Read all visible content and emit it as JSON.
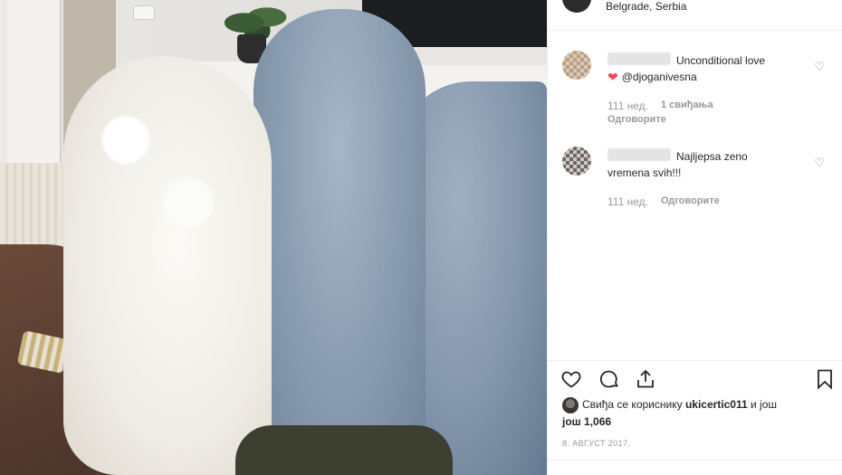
{
  "header": {
    "location": "Belgrade, Serbia"
  },
  "comments": [
    {
      "text_line1": "Unconditional love",
      "mention": "@djoganivesna",
      "age": "111 нед.",
      "likes": "1 свиђања",
      "reply": "Одговорите"
    },
    {
      "text_line1": "Najljepsa zeno",
      "text_line2": "vremena svih!!!",
      "age": "111 нед.",
      "reply": "Одговорите"
    }
  ],
  "likes_summary": {
    "prefix": "Свиђа се кориснику",
    "user": "ukicertic011",
    "suffix": "и још",
    "more_prefix": "још",
    "count": "1,066"
  },
  "post_date": "8. АВГУСТ 2017.",
  "colors": {
    "heart": "#ed4956",
    "muted": "#999999",
    "text": "#262626"
  }
}
